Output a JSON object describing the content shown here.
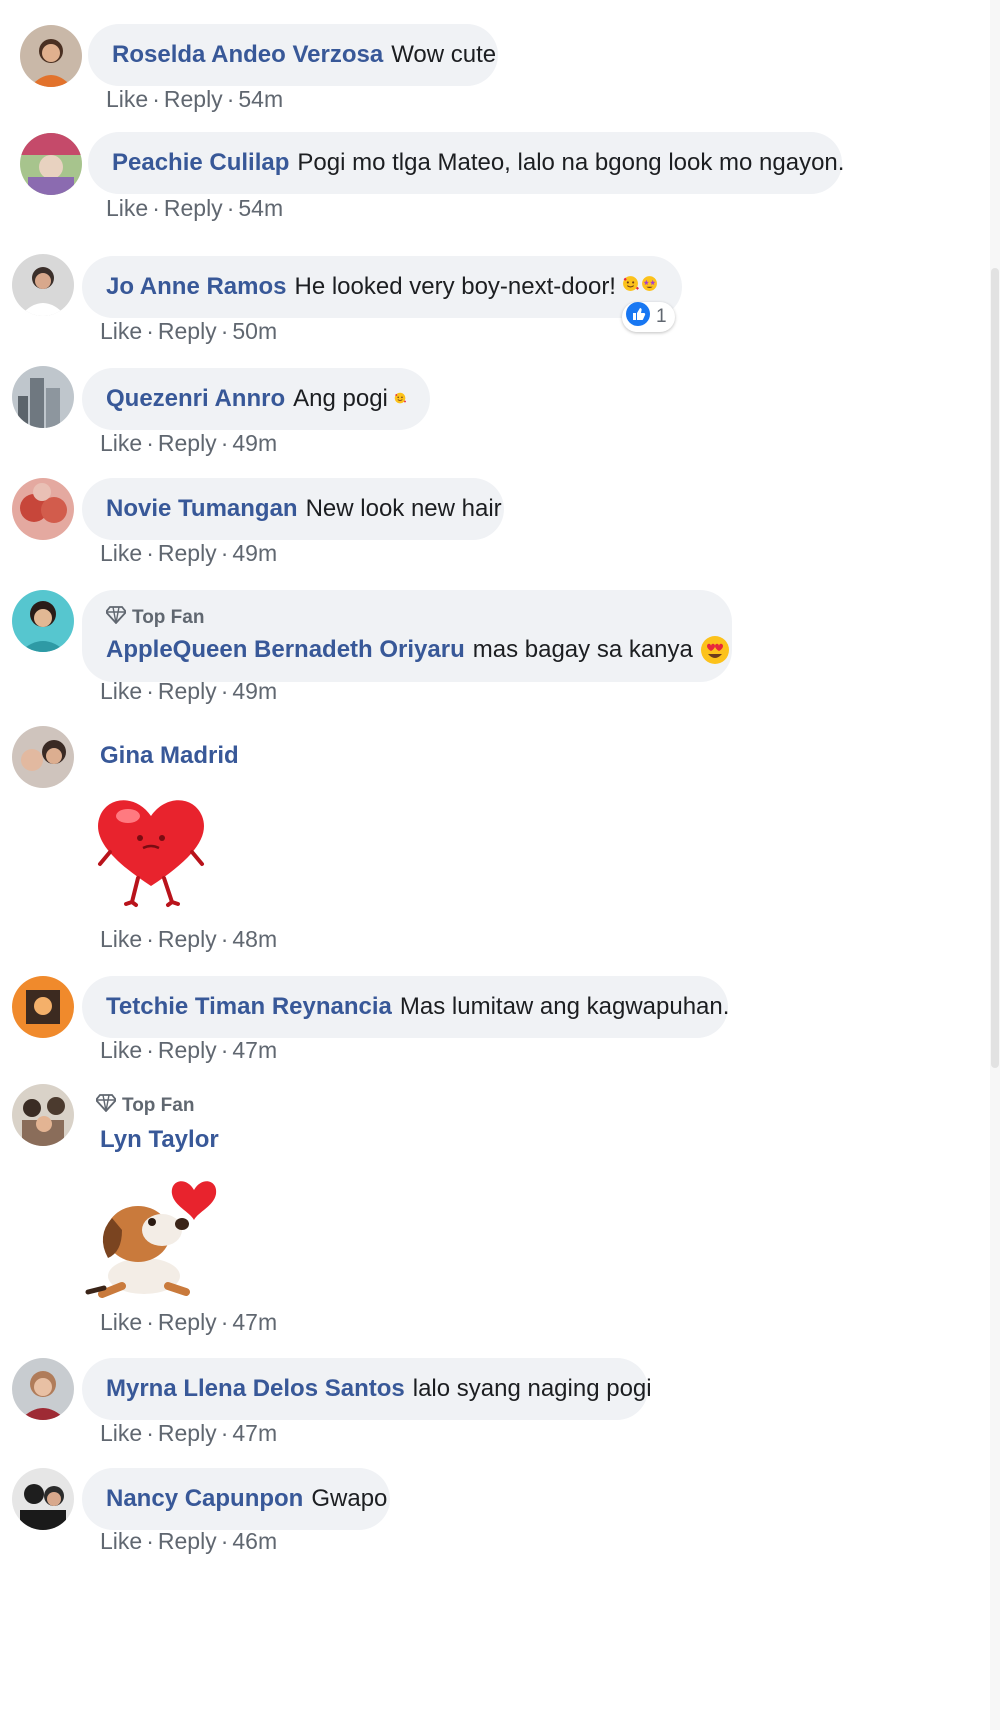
{
  "actions": {
    "like": "Like",
    "reply": "Reply",
    "dot": "·"
  },
  "top_fan_label": "Top Fan",
  "comments": [
    {
      "name": "Roselda Andeo Verzosa",
      "text": "Wow cute",
      "time": "54m"
    },
    {
      "name": "Peachie Culilap",
      "text": "Pogi mo tlga Mateo, lalo na bgong look mo ngayon.",
      "time": "54m"
    },
    {
      "name": "Jo Anne Ramos",
      "text": "He looked very boy-next-door!",
      "time": "50m",
      "emojis": [
        "smiling-face-with-hearts",
        "star-struck"
      ],
      "reaction": {
        "icon": "like-thumb-icon",
        "count": "1"
      }
    },
    {
      "name": "Quezenri Annro",
      "text": "Ang pogi",
      "time": "49m",
      "emojis": [
        "smiling-face-with-hearts"
      ]
    },
    {
      "name": "Novie Tumangan",
      "text": "New look new hair",
      "time": "49m"
    },
    {
      "name": "AppleQueen Bernadeth Oriyaru",
      "text": "mas bagay sa kanya",
      "time": "49m",
      "top_fan": true,
      "emojis": [
        "heart-eyes"
      ]
    },
    {
      "name": "Gina Madrid",
      "text": "",
      "time": "48m",
      "sticker": "red-heart-sticker"
    },
    {
      "name": "Tetchie Timan Reynancia",
      "text": "Mas lumitaw ang kagwapuhan.",
      "time": "47m"
    },
    {
      "name": "Lyn Taylor",
      "text": "",
      "time": "47m",
      "top_fan": true,
      "sticker": "puppy-heart-sticker"
    },
    {
      "name": "Myrna Llena Delos Santos",
      "text": "lalo syang naging pogi",
      "time": "47m"
    },
    {
      "name": "Nancy Capunpon",
      "text": "Gwapo",
      "time": "46m"
    }
  ],
  "colors": {
    "name": "#385898",
    "bubble": "#f0f2f5",
    "meta": "#606770"
  }
}
